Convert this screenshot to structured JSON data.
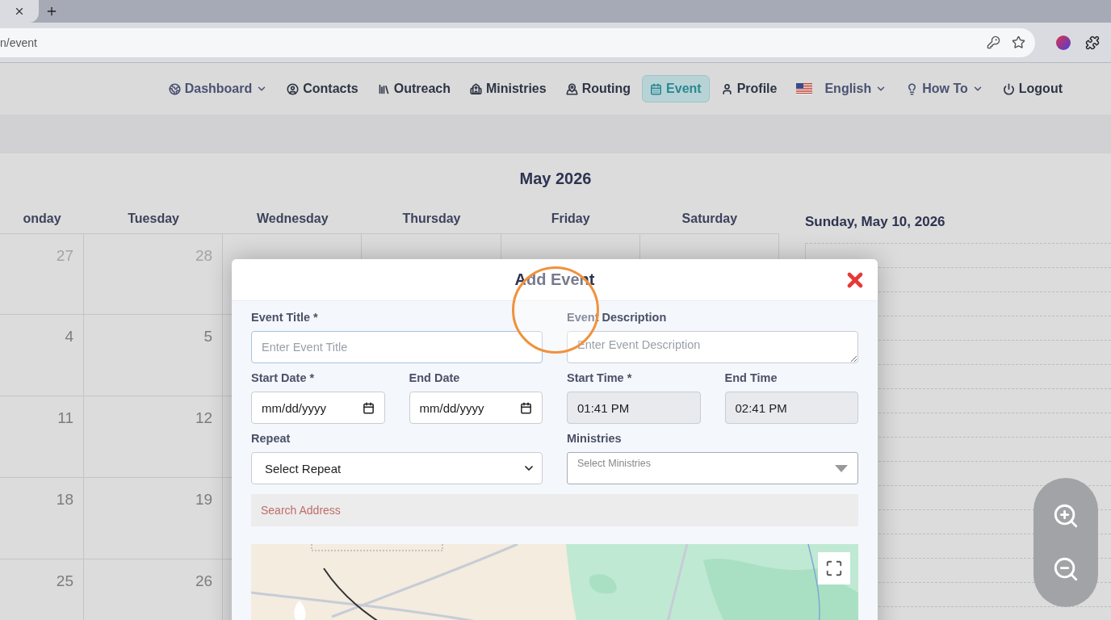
{
  "browser": {
    "url": "n/event"
  },
  "nav": {
    "items": [
      {
        "label": "Dashboard",
        "kind": "dropdown",
        "selected": false
      },
      {
        "label": "Contacts",
        "kind": "link",
        "selected": false
      },
      {
        "label": "Outreach",
        "kind": "link",
        "selected": false
      },
      {
        "label": "Ministries",
        "kind": "link",
        "selected": false
      },
      {
        "label": "Routing",
        "kind": "link",
        "selected": false
      },
      {
        "label": "Event",
        "kind": "link",
        "selected": true
      },
      {
        "label": "Profile",
        "kind": "link",
        "selected": false
      },
      {
        "label": "English",
        "kind": "dropdown",
        "selected": false
      },
      {
        "label": "How To",
        "kind": "dropdown",
        "selected": false
      },
      {
        "label": "Logout",
        "kind": "link",
        "selected": false
      }
    ]
  },
  "calendar": {
    "title": "May 2026",
    "weekdays": [
      "onday",
      "Tuesday",
      "Wednesday",
      "Thursday",
      "Friday",
      "Saturday"
    ],
    "weeks": [
      {
        "cells": [
          {
            "day": "27",
            "muted": true,
            "weekend": false
          },
          {
            "day": "28",
            "muted": true,
            "weekend": false
          }
        ]
      },
      {
        "cells": [
          {
            "day": "4",
            "muted": false,
            "weekend": false
          },
          {
            "day": "5",
            "muted": false,
            "weekend": false
          }
        ]
      },
      {
        "cells": [
          {
            "day": "11",
            "muted": false,
            "weekend": false
          },
          {
            "day": "12",
            "muted": false,
            "weekend": false
          }
        ]
      },
      {
        "cells": [
          {
            "day": "18",
            "muted": false,
            "weekend": false
          },
          {
            "day": "19",
            "muted": false,
            "weekend": false
          }
        ]
      },
      {
        "cells": [
          {
            "day": "25",
            "muted": false,
            "weekend": false
          },
          {
            "day": "26",
            "muted": false,
            "weekend": false
          }
        ]
      }
    ]
  },
  "day_view": {
    "title": "Sunday, May 10, 2026"
  },
  "modal": {
    "title": "Add Event",
    "event_title": {
      "label": "Event Title *",
      "placeholder": "Enter Event Title"
    },
    "event_description": {
      "label": "Event Description",
      "placeholder": "Enter Event Description"
    },
    "start_date": {
      "label": "Start Date *",
      "value": "mm/dd/yyyy"
    },
    "end_date": {
      "label": "End Date",
      "value": "mm/dd/yyyy"
    },
    "start_time": {
      "label": "Start Time *",
      "value": "01:41 PM",
      "disabled": true
    },
    "end_time": {
      "label": "End Time",
      "value": "02:41 PM",
      "disabled": true
    },
    "repeat": {
      "label": "Repeat",
      "value": "Select Repeat"
    },
    "ministries": {
      "label": "Ministries",
      "placeholder": "Select Ministries"
    },
    "address": {
      "placeholder": "Search Address"
    }
  }
}
